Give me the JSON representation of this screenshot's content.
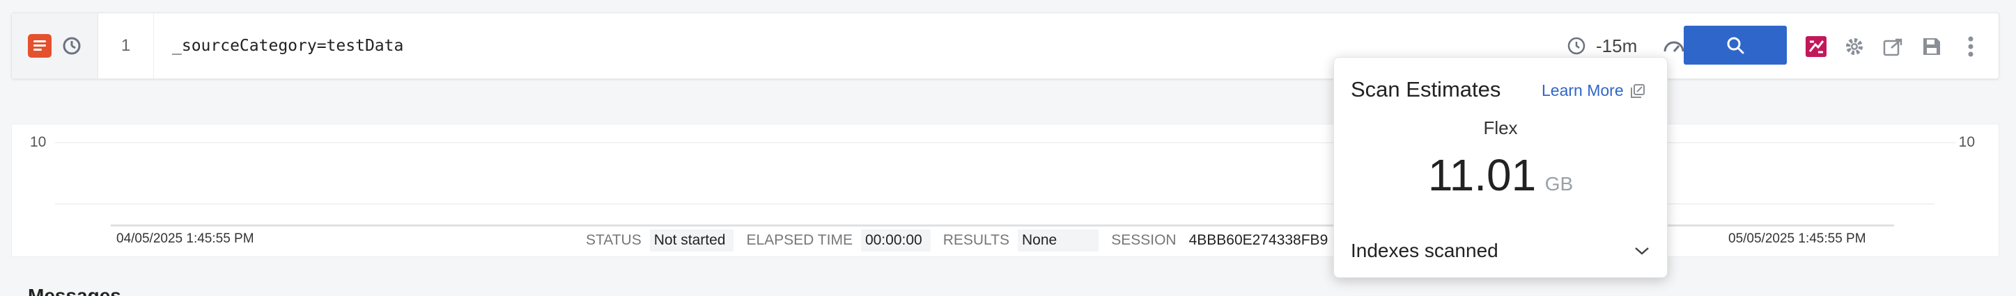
{
  "query": {
    "line_number": "1",
    "text": "_sourceCategory=testData",
    "time_range": "-15m"
  },
  "icons": {
    "messages": "messages-icon",
    "aggregates": "aggregates-icon",
    "clock": "clock-icon",
    "speed": "speedometer-icon",
    "search": "search-icon",
    "compare": "compare-icon",
    "settings": "gear-icon",
    "share": "share-icon",
    "save": "save-icon",
    "more": "more-vertical-icon"
  },
  "histogram": {
    "y_max_left": "10",
    "y_max_right": "10",
    "start_time": "04/05/2025 1:45:55 PM",
    "end_time": "05/05/2025 1:45:55 PM"
  },
  "status_bar": {
    "status_label": "STATUS",
    "status_value": "Not started",
    "elapsed_label": "ELAPSED TIME",
    "elapsed_value": "00:00:00",
    "results_label": "RESULTS",
    "results_value": "None",
    "session_label": "SESSION",
    "session_value": "4BBB60E274338FB9"
  },
  "messages": {
    "title": "Messages"
  },
  "scan_estimates": {
    "title": "Scan Estimates",
    "learn_more": "Learn More",
    "tier": "Flex",
    "value": "11.01",
    "unit": "GB",
    "indexes_label": "Indexes scanned"
  },
  "colors": {
    "accent": "#2f66c9",
    "messages_icon": "#e5512e",
    "compare_icon": "#c2185b"
  }
}
